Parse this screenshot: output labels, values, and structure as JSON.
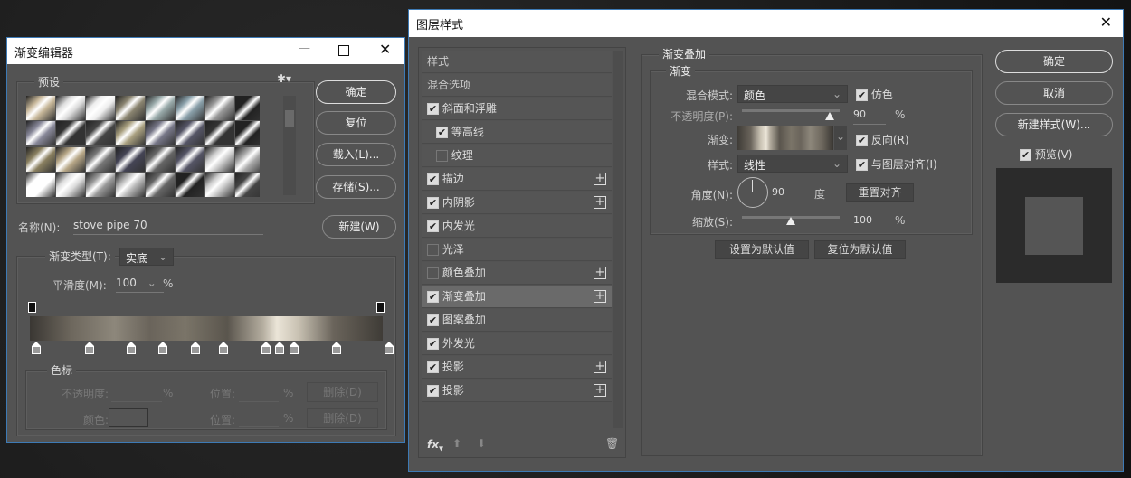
{
  "gradient_editor": {
    "title": "渐变编辑器",
    "presets_label": "预设",
    "buttons": {
      "ok": "确定",
      "reset": "复位",
      "load": "载入(L)...",
      "save": "存储(S)...",
      "new": "新建(W)"
    },
    "name_label": "名称(N):",
    "name_value": "stove pipe 70",
    "type_label": "渐变类型(T):",
    "type_value": "实底",
    "smooth_label": "平滑度(M):",
    "smooth_value": "100",
    "percent": "%",
    "stops_group": "色标",
    "opacity_label": "不透明度:",
    "location_label": "位置:",
    "delete_label": "删除(D)",
    "color_label": "颜色:",
    "color_stops_percent": [
      0,
      15,
      27,
      36,
      45,
      53,
      65,
      69,
      73,
      85,
      100
    ],
    "opacity_stops_percent": [
      0,
      100
    ]
  },
  "layer_style": {
    "title": "图层样式",
    "list": [
      {
        "label": "样式",
        "type": "header"
      },
      {
        "label": "混合选项",
        "type": "header"
      },
      {
        "label": "斜面和浮雕",
        "checked": true
      },
      {
        "label": "等高线",
        "checked": true,
        "indent": true
      },
      {
        "label": "纹理",
        "checked": false,
        "indent": true
      },
      {
        "label": "描边",
        "checked": true,
        "plus": true
      },
      {
        "label": "内阴影",
        "checked": true,
        "plus": true
      },
      {
        "label": "内发光",
        "checked": true
      },
      {
        "label": "光泽",
        "checked": false
      },
      {
        "label": "颜色叠加",
        "checked": false,
        "plus": true
      },
      {
        "label": "渐变叠加",
        "checked": true,
        "plus": true,
        "selected": true
      },
      {
        "label": "图案叠加",
        "checked": true
      },
      {
        "label": "外发光",
        "checked": true
      },
      {
        "label": "投影",
        "checked": true,
        "plus": true
      },
      {
        "label": "投影",
        "checked": true,
        "plus": true
      }
    ],
    "section_title": "渐变叠加",
    "sub_title": "渐变",
    "blend_label": "混合模式:",
    "blend_value": "颜色",
    "dither_label": "仿色",
    "opacity_label": "不透明度(P):",
    "opacity_value": "90",
    "opacity_level": 90,
    "gradient_label": "渐变:",
    "reverse_label": "反向(R)",
    "style_label": "样式:",
    "style_value": "线性",
    "align_label": "与图层对齐(I)",
    "angle_label": "角度(N):",
    "angle_value": "90",
    "angle_unit": "度",
    "reset_align": "重置对齐",
    "scale_label": "缩放(S):",
    "scale_value": "100",
    "scale_level": 100,
    "percent": "%",
    "set_default": "设置为默认值",
    "reset_default": "复位为默认值",
    "buttons": {
      "ok": "确定",
      "cancel": "取消",
      "new_style": "新建样式(W)..."
    },
    "preview_label": "预览(V)"
  }
}
